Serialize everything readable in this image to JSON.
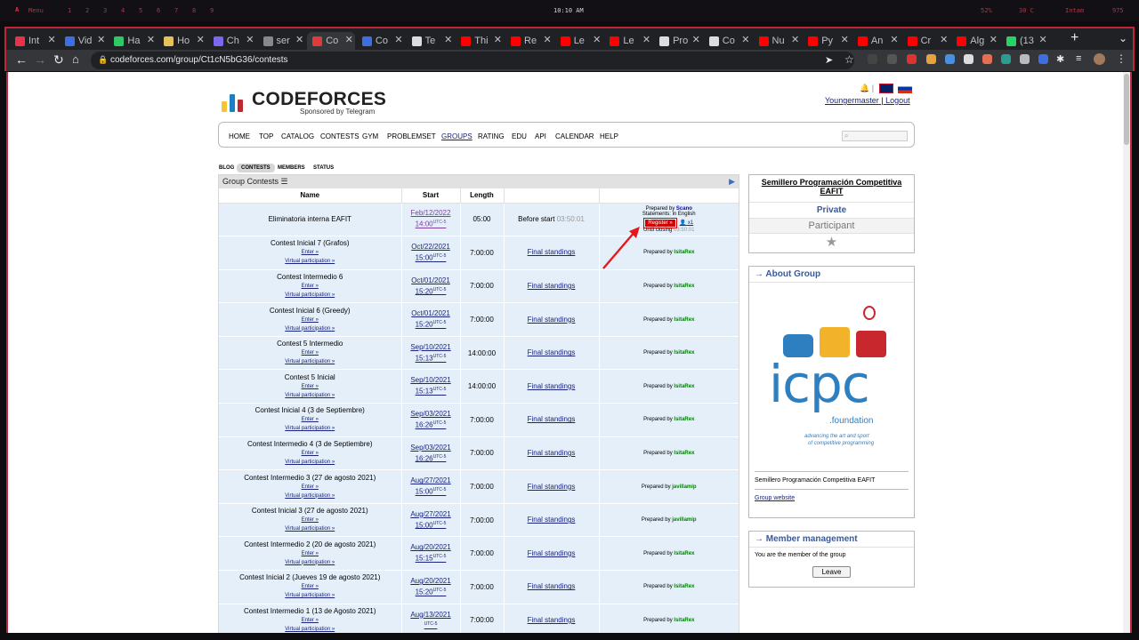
{
  "topbar": {
    "logo": "A",
    "menu": "Menu",
    "workspaces": [
      "1",
      "2",
      "3",
      "4",
      "5",
      "6",
      "7",
      "8",
      "9"
    ],
    "clock": "10:10 AM",
    "status": [
      "52%",
      "30 C",
      "Intam",
      "975"
    ]
  },
  "tabs": [
    {
      "label": "Int",
      "color": "#e8324b"
    },
    {
      "label": "Vid",
      "color": "#3d6fe0"
    },
    {
      "label": "Ha",
      "color": "#2ec866"
    },
    {
      "label": "Ho",
      "color": "#e6c15a"
    },
    {
      "label": "Ch",
      "color": "#7b68ee"
    },
    {
      "label": "ser",
      "color": "#888888"
    },
    {
      "label": "Co",
      "color": "#e03b3b"
    },
    {
      "label": "Co",
      "color": "#3d6fe0"
    },
    {
      "label": "Te",
      "color": "#dddddd"
    },
    {
      "label": "Thi",
      "color": "#ff0000"
    },
    {
      "label": "Re",
      "color": "#ff0000"
    },
    {
      "label": "Le",
      "color": "#ff0000"
    },
    {
      "label": "Le",
      "color": "#ff0000"
    },
    {
      "label": "Pro",
      "color": "#dddddd"
    },
    {
      "label": "Co",
      "color": "#dddddd"
    },
    {
      "label": "Nu",
      "color": "#ff0000"
    },
    {
      "label": "Py",
      "color": "#ff0000"
    },
    {
      "label": "An",
      "color": "#ff0000"
    },
    {
      "label": "Cr",
      "color": "#ff0000"
    },
    {
      "label": "Alg",
      "color": "#ff0000"
    },
    {
      "label": "(13",
      "color": "#25d366"
    }
  ],
  "address": {
    "url": "codeforces.com/group/Ct1cN5bG36/contests"
  },
  "header": {
    "logo_text": "CODEFORCES",
    "sponsor": "Sponsored by Telegram",
    "user": "Youngermaster",
    "sep": "|",
    "logout": "Logout"
  },
  "nav": [
    "HOME",
    "TOP",
    "CATALOG",
    "CONTESTS",
    "GYM",
    "PROBLEMSET",
    "GROUPS",
    "RATING",
    "EDU",
    "API",
    "CALENDAR",
    "HELP"
  ],
  "subnav": [
    "BLOG",
    "CONTESTS",
    "MEMBERS",
    "STATUS"
  ],
  "contests": {
    "title": "Group Contests",
    "headers": [
      "Name",
      "Start",
      "Length",
      "",
      ""
    ],
    "enter": "Enter »",
    "virtual": "Virtual participation »",
    "standings": "Final standings",
    "prepared": "Prepared by",
    "first": {
      "name": "Eliminatoria interna EAFIT",
      "date": "Feb/12/2022",
      "time": "14:00",
      "utc": "UTC-5",
      "length": "05:00",
      "before": "Before start",
      "countdown": "03:50:01",
      "prepared_by": "Prepared by",
      "author": "Scano",
      "statements": "Statements: in English",
      "register": "Register »",
      "participants": "x1",
      "until": "Until closing",
      "until_time": "03:50:01"
    },
    "rows": [
      {
        "name": "Contest Inicial 7 (Grafos)",
        "date": "Oct/22/2021",
        "time": "15:00",
        "length": "7:00:00",
        "author": "IsitaRex"
      },
      {
        "name": "Contest Intermedio 6",
        "date": "Oct/01/2021",
        "time": "15:20",
        "length": "7:00:00",
        "author": "IsitaRex"
      },
      {
        "name": "Contest Inicial 6 (Greedy)",
        "date": "Oct/01/2021",
        "time": "15:20",
        "length": "7:00:00",
        "author": "IsitaRex"
      },
      {
        "name": "Contest 5 Intermedio",
        "date": "Sep/10/2021",
        "time": "15:13",
        "length": "14:00:00",
        "author": "IsitaRex"
      },
      {
        "name": "Contest 5 Inicial",
        "date": "Sep/10/2021",
        "time": "15:13",
        "length": "14:00:00",
        "author": "IsitaRex"
      },
      {
        "name": "Contest Inicial 4 (3 de Septiembre)",
        "date": "Sep/03/2021",
        "time": "16:26",
        "length": "7:00:00",
        "author": "IsitaRex"
      },
      {
        "name": "Contest Intermedio 4 (3 de Septiembre)",
        "date": "Sep/03/2021",
        "time": "16:26",
        "length": "7:00:00",
        "author": "IsitaRex"
      },
      {
        "name": "Contest Intermedio 3 (27 de agosto 2021)",
        "date": "Aug/27/2021",
        "time": "15:00",
        "length": "7:00:00",
        "author": "javillamip"
      },
      {
        "name": "Contest Inicial 3 (27 de agosto 2021)",
        "date": "Aug/27/2021",
        "time": "15:00",
        "length": "7:00:00",
        "author": "javillamip"
      },
      {
        "name": "Contest Intermedio 2 (20 de agosto 2021)",
        "date": "Aug/20/2021",
        "time": "15:15",
        "length": "7:00:00",
        "author": "IsitaRex"
      },
      {
        "name": "Contest Inicial 2 (Jueves 19 de agosto 2021)",
        "date": "Aug/20/2021",
        "time": "15:20",
        "length": "7:00:00",
        "author": "IsitaRex"
      },
      {
        "name": "Contest Intermedio 1 (13 de Agosto 2021)",
        "date": "Aug/13/2021",
        "time": "",
        "length": "7:00:00",
        "author": "IsitaRex"
      }
    ]
  },
  "sidebar": {
    "group_name": "Semillero Programación Competitiva EAFIT",
    "privacy": "Private",
    "role": "Participant",
    "about_title": "About Group",
    "icpc_text": "icpc",
    "icpc_sub": ".foundation",
    "icpc_tag1": "advancing the art and sport",
    "icpc_tag2": "of competitive programming",
    "about_desc": "Semillero Programación Competitiva EAFIT",
    "website": "Group website",
    "member_title": "Member management",
    "member_text": "You are the member of the group",
    "leave": "Leave"
  }
}
